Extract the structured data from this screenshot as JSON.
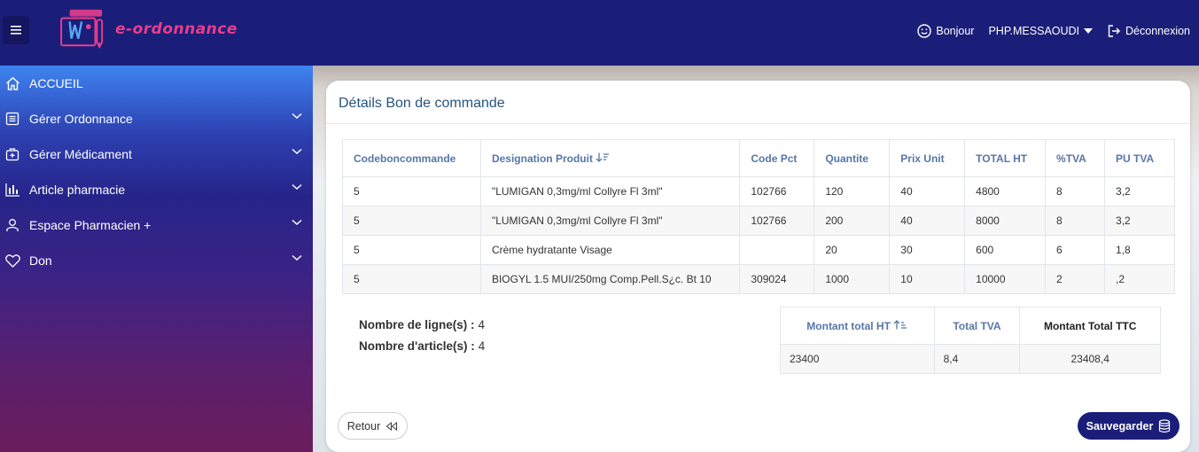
{
  "app": {
    "logo_text": "e-ordonnance"
  },
  "header": {
    "greeting": "Bonjour",
    "user": "PHP.MESSAOUDI",
    "logout": "Déconnexion"
  },
  "sidebar": {
    "items": [
      {
        "label": "ACCUEIL"
      },
      {
        "label": "Gérer Ordonnance"
      },
      {
        "label": "Gérer Médicament"
      },
      {
        "label": "Article pharmacie"
      },
      {
        "label": "Espace Pharmacien +"
      },
      {
        "label": "Don"
      }
    ]
  },
  "main": {
    "title": "Détails Bon de commande",
    "table": {
      "headers": [
        "Codeboncommande",
        "Designation Produit",
        "Code Pct",
        "Quantite",
        "Prix Unit",
        "TOTAL HT",
        "%TVA",
        "PU TVA"
      ],
      "rows": [
        [
          "5",
          "\"LUMIGAN 0,3mg/ml Collyre Fl 3ml\"",
          "102766",
          "120",
          "40",
          "4800",
          "8",
          "3,2"
        ],
        [
          "5",
          "\"LUMIGAN 0,3mg/ml Collyre Fl 3ml\"",
          "102766",
          "200",
          "40",
          "8000",
          "8",
          "3,2"
        ],
        [
          "5",
          "Crème hydratante Visage",
          "",
          "20",
          "30",
          "600",
          "6",
          "1,8"
        ],
        [
          "5",
          "BIOGYL 1.5 MUI/250mg Comp.Pell.S¿c. Bt 10",
          "309024",
          "1000",
          "10",
          "10000",
          "2",
          ",2"
        ]
      ]
    },
    "summary": {
      "lines_label": "Nombre de ligne(s) :",
      "lines_value": "4",
      "articles_label": "Nombre d'article(s) :",
      "articles_value": "4"
    },
    "totals": {
      "headers": [
        "Montant total HT",
        "Total TVA",
        "Montant Total TTC"
      ],
      "values": [
        "23400",
        "8,4",
        "23408,4"
      ]
    },
    "buttons": {
      "back": "Retour",
      "save": "Sauvegarder"
    }
  },
  "colors": {
    "topbar": "#1b1e78",
    "accent": "#5876a8",
    "title": "#27547f"
  }
}
